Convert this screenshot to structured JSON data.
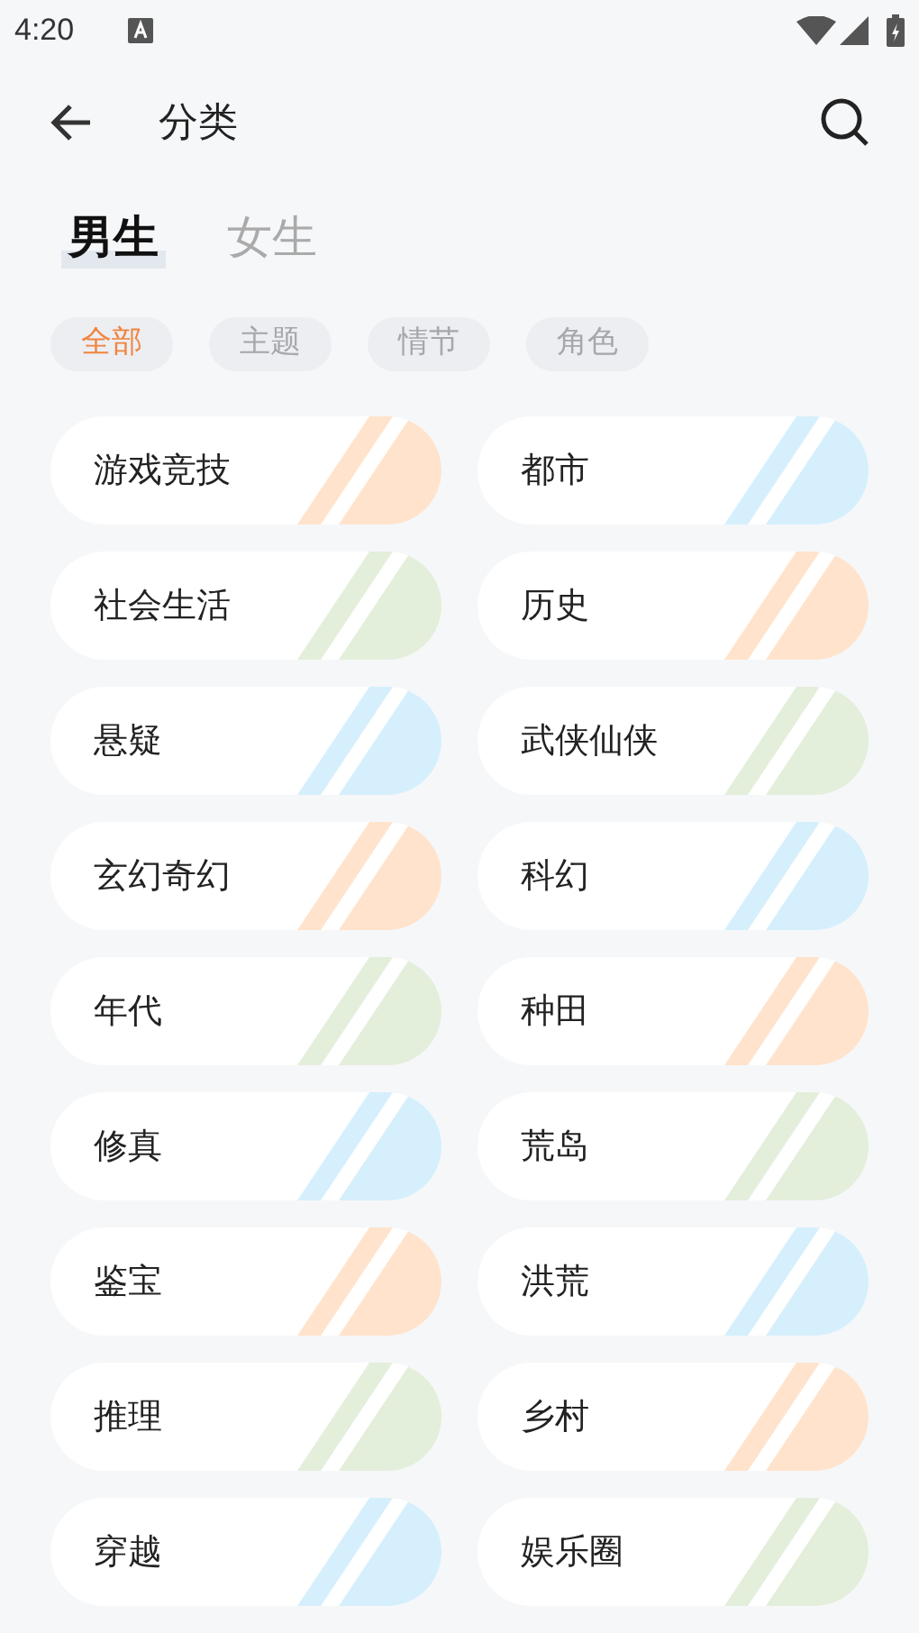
{
  "status_bar": {
    "time": "4:20"
  },
  "header": {
    "title": "分类"
  },
  "tabs": [
    {
      "label": "男生",
      "selected": true
    },
    {
      "label": "女生",
      "selected": false
    }
  ],
  "filters": [
    {
      "label": "全部",
      "selected": true
    },
    {
      "label": "主题",
      "selected": false
    },
    {
      "label": "情节",
      "selected": false
    },
    {
      "label": "角色",
      "selected": false
    }
  ],
  "categories": [
    {
      "label": "游戏竞技",
      "color": "#ffe3cc"
    },
    {
      "label": "都市",
      "color": "#d6effc"
    },
    {
      "label": "社会生活",
      "color": "#e3eedb"
    },
    {
      "label": "历史",
      "color": "#ffe3cc"
    },
    {
      "label": "悬疑",
      "color": "#d6effc"
    },
    {
      "label": "武侠仙侠",
      "color": "#e3eedb"
    },
    {
      "label": "玄幻奇幻",
      "color": "#ffe3cc"
    },
    {
      "label": "科幻",
      "color": "#d6effc"
    },
    {
      "label": "年代",
      "color": "#e3eedb"
    },
    {
      "label": "种田",
      "color": "#ffe3cc"
    },
    {
      "label": "修真",
      "color": "#d6effc"
    },
    {
      "label": "荒岛",
      "color": "#e3eedb"
    },
    {
      "label": "鉴宝",
      "color": "#ffe3cc"
    },
    {
      "label": "洪荒",
      "color": "#d6effc"
    },
    {
      "label": "推理",
      "color": "#e3eedb"
    },
    {
      "label": "乡村",
      "color": "#ffe3cc"
    },
    {
      "label": "穿越",
      "color": "#d6effc"
    },
    {
      "label": "娱乐圈",
      "color": "#e3eedb"
    }
  ]
}
